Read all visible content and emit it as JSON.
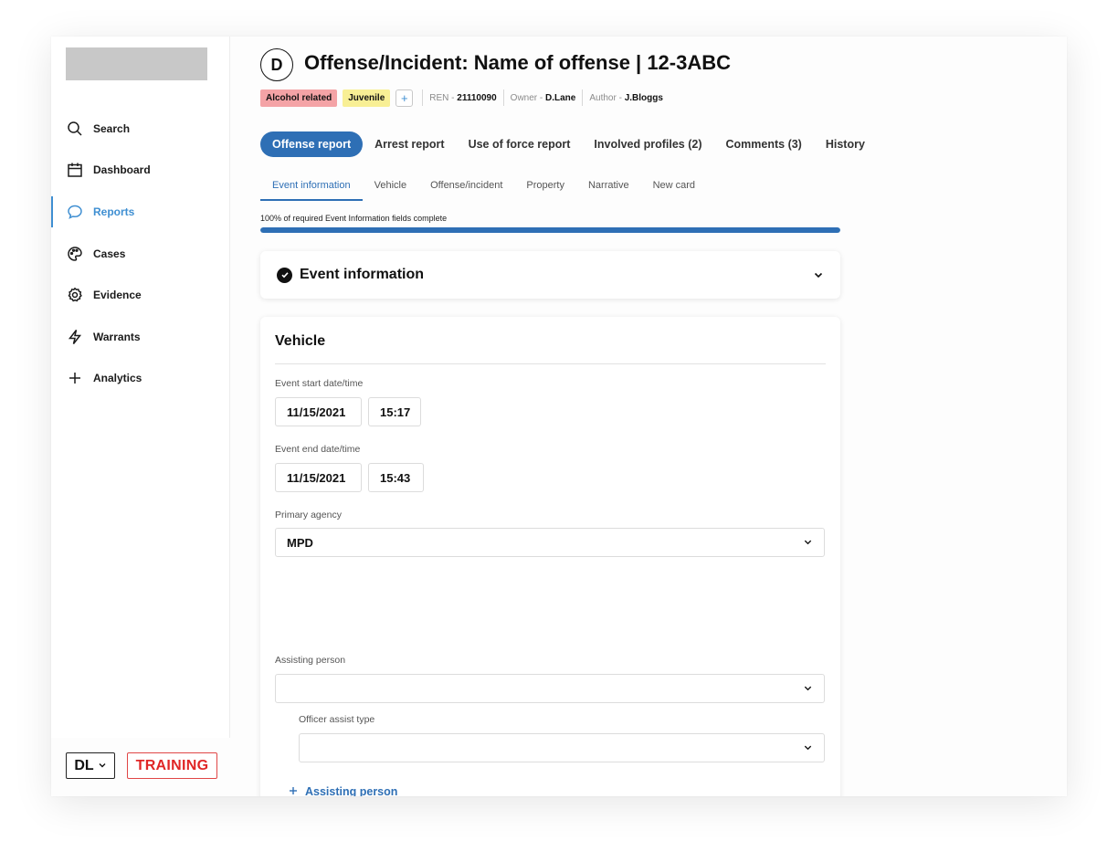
{
  "sidebar": {
    "items": [
      {
        "label": "Search",
        "icon": "search-icon"
      },
      {
        "label": "Dashboard",
        "icon": "calendar-icon"
      },
      {
        "label": "Reports",
        "icon": "chat-bubble-icon",
        "active": true
      },
      {
        "label": "Cases",
        "icon": "palette-icon"
      },
      {
        "label": "Evidence",
        "icon": "gear-icon"
      },
      {
        "label": "Warrants",
        "icon": "lightning-icon"
      },
      {
        "label": "Analytics",
        "icon": "plus-icon"
      }
    ],
    "user_initials": "DL",
    "training_label": "TRAINING"
  },
  "header": {
    "avatar_letter": "D",
    "title": "Offense/Incident: Name of offense | 12-3ABC",
    "tags": [
      {
        "label": "Alcohol related",
        "color": "#f4a3a6"
      },
      {
        "label": "Juvenile",
        "color": "#f8ef95"
      }
    ],
    "add_tag_label": "+",
    "ren_label": "REN - ",
    "ren_value": "21110090",
    "owner_label": "Owner - ",
    "owner_value": "D.Lane",
    "author_label": "Author - ",
    "author_value": "J.Bloggs"
  },
  "tabs": [
    {
      "label": "Offense report",
      "active": true
    },
    {
      "label": "Arrest report"
    },
    {
      "label": "Use of force report"
    },
    {
      "label": "Involved profiles (2)"
    },
    {
      "label": "Comments (3)"
    },
    {
      "label": "History"
    }
  ],
  "subtabs": [
    {
      "label": "Event information",
      "active": true
    },
    {
      "label": "Vehicle"
    },
    {
      "label": "Offense/incident"
    },
    {
      "label": "Property"
    },
    {
      "label": "Narrative"
    },
    {
      "label": "New card"
    }
  ],
  "progress": {
    "label": "100% of required Event Information fields complete",
    "percent": 100
  },
  "event_card": {
    "title": "Event information"
  },
  "vehicle_card": {
    "title": "Vehicle",
    "start_label": "Event start date/time",
    "start_date": "11/15/2021",
    "start_time": "15:17",
    "end_label": "Event end date/time",
    "end_date": "11/15/2021",
    "end_time": "15:43",
    "agency_label": "Primary agency",
    "agency_value": "MPD",
    "assisting_label": "Assisting person",
    "assisting_value": "",
    "assist_type_label": "Officer assist type",
    "assist_type_value": "",
    "add_assisting_label": "Assisting person"
  },
  "colors": {
    "accent": "#2e6fb5",
    "active_nav": "#3f8fd2",
    "training": "#e02626"
  }
}
